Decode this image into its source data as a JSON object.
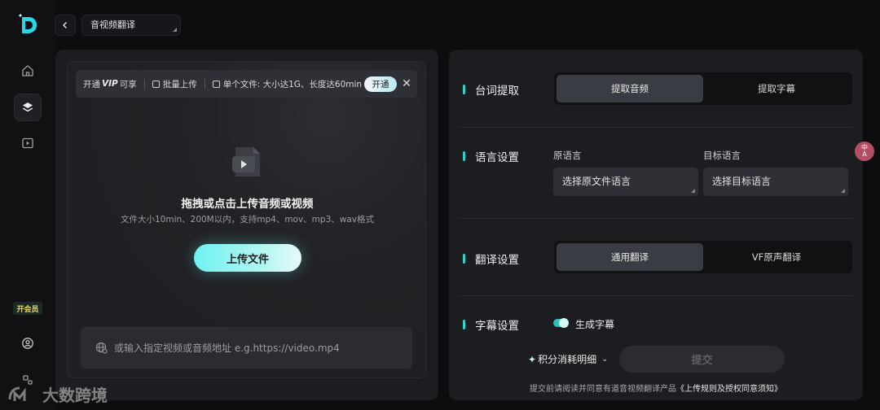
{
  "app": {
    "mode_select": "音视频翻译",
    "vip_badge": "开会员"
  },
  "upload": {
    "vip_bar": {
      "open_prefix": "开通",
      "vip": "VIP",
      "open_suffix": "可享",
      "batch": "批量上传",
      "single_file": "单个文件: 大小达1G、长度达60min",
      "open_button": "开通"
    },
    "drop_title": "拖拽或点击上传音频或视频",
    "drop_subtitle": "文件大小10min、200M以内，支持mp4、mov、mp3、wav格式",
    "upload_button": "上传文件",
    "url_placeholder": "或输入指定视频或音频地址 e.g.https://video.mp4"
  },
  "settings": {
    "extract": {
      "label": "台词提取",
      "options": [
        "提取音频",
        "提取字幕"
      ],
      "selected": "提取音频"
    },
    "language": {
      "label": "语言设置",
      "source_label": "原语言",
      "source_placeholder": "选择原文件语言",
      "target_label": "目标语言",
      "target_placeholder": "选择目标语言"
    },
    "translation": {
      "label": "翻译设置",
      "options": [
        "通用翻译",
        "VF原声翻译"
      ],
      "selected": "通用翻译"
    },
    "subtitle": {
      "label": "字幕设置",
      "toggle_label": "生成字幕",
      "toggle_on": true
    },
    "points_detail": "积分消耗明细",
    "submit": "提交",
    "terms_prefix": "提交前请阅读并同意有道音视频翻译产品",
    "terms_link": "《上传规则及授权同意须知》"
  },
  "floating": {
    "translate_top": "中",
    "translate_bottom": "A"
  },
  "watermark": "大数跨境",
  "icons": {
    "logo": "app-logo-icon",
    "home": "home-icon",
    "layers": "layers-icon",
    "video": "play-square-icon",
    "user": "user-circle-icon",
    "apps": "apps-icon",
    "back": "chevron-left-icon",
    "globe": "globe-icon",
    "file": "video-file-icon"
  },
  "colors": {
    "accent": "#2fd3c7",
    "upload_gradient_start": "#6ff2f1",
    "background": "#0d0d0f",
    "panel": "#1c1d20"
  }
}
